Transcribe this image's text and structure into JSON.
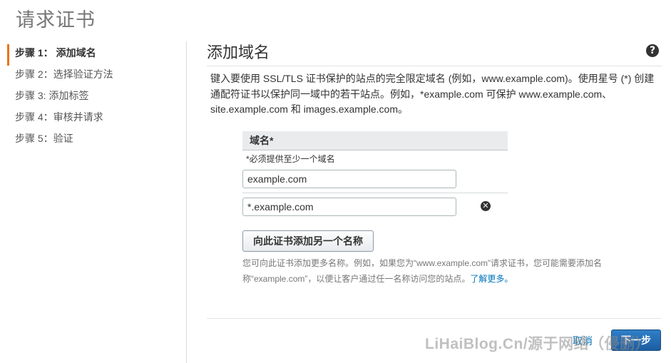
{
  "page": {
    "title": "请求证书"
  },
  "steps": [
    {
      "label": "步骤 1：  添加域名",
      "active": true
    },
    {
      "label": "步骤 2：选择验证方法",
      "active": false
    },
    {
      "label": "步骤 3: 添加标签",
      "active": false
    },
    {
      "label": "步骤 4：审核并请求",
      "active": false
    },
    {
      "label": "步骤 5：验证",
      "active": false
    }
  ],
  "section": {
    "title": "添加域名",
    "help_glyph": "?",
    "intro": "键入要使用 SSL/TLS 证书保护的站点的完全限定域名 (例如，www.example.com)。使用星号 (*) 创建通配符证书以保护同一域中的若干站点。例如，*example.com 可保护 www.example.com、site.example.com 和 images.example.com。"
  },
  "domains": {
    "header": "域名*",
    "hint": "*必须提供至少一个域名",
    "values": [
      "example.com",
      "*.example.com"
    ],
    "remove_glyph": "✕",
    "add_button": "向此证书添加另一个名称",
    "note": "您可向此证书添加更多名称。例如，如果您为“www.example.com”请求证书，您可能需要添加名称“example.com”，以便让客户通过任一名称访问您的站点。",
    "learn_more": "了解更多。"
  },
  "footer": {
    "cancel": "取消",
    "next": "下一步"
  },
  "watermark": "LiHaiBlog.Cn/源于网络（侵删）",
  "colors": {
    "accent": "#ec7211",
    "link": "#0073bb",
    "primary_button": "#1d5da0"
  }
}
